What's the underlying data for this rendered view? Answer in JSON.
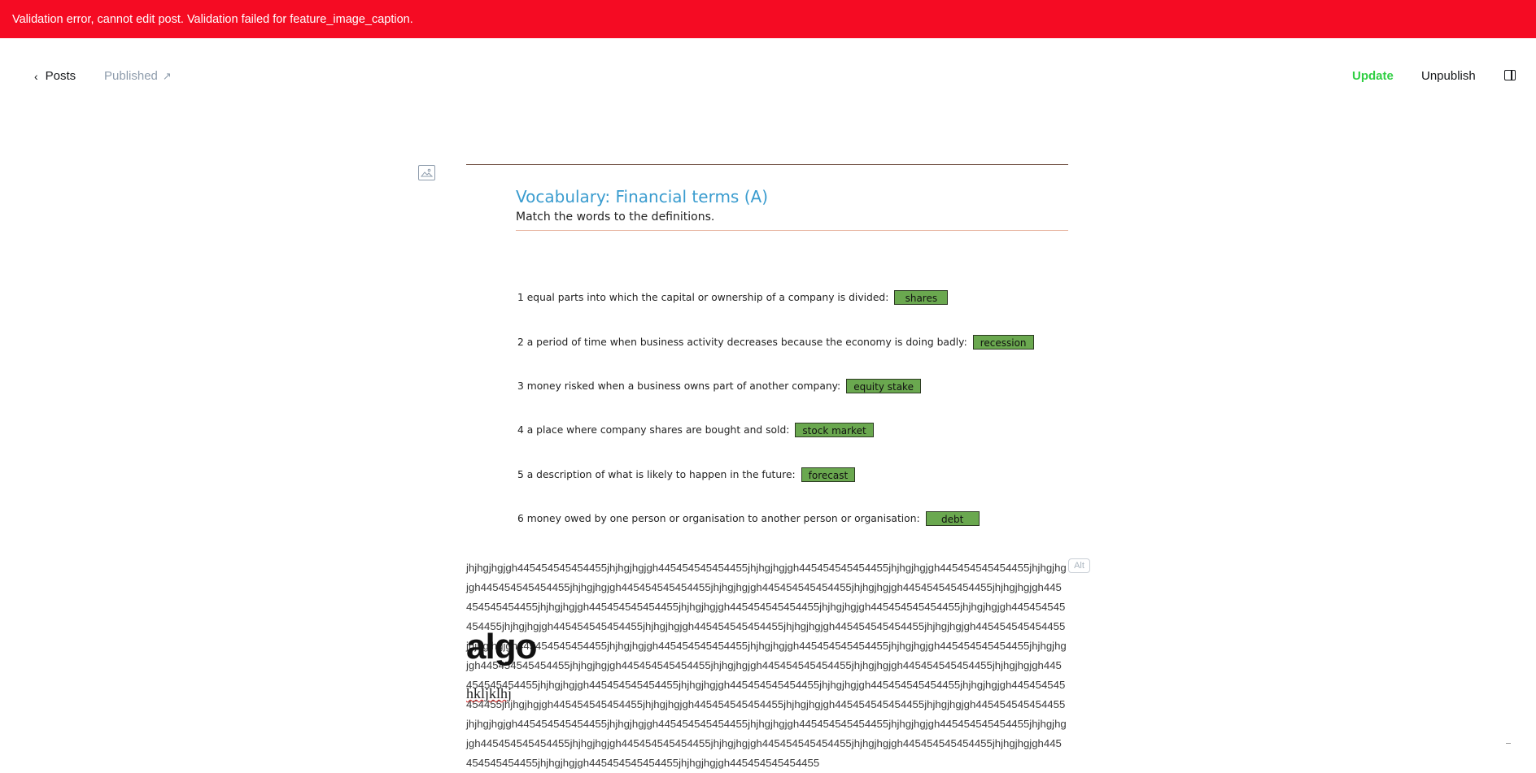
{
  "error_banner": {
    "message": "Validation error, cannot edit post. Validation failed for feature_image_caption."
  },
  "nav": {
    "back_label": "Posts",
    "status_label": "Published",
    "update_label": "Update",
    "unpublish_label": "Unpublish"
  },
  "feature_image": {
    "title": "Vocabulary: Financial terms (A)",
    "subtitle": "Match the words to the definitions.",
    "items": [
      {
        "text": "1 equal parts into which the capital or ownership of a company is divided:",
        "answer": "shares"
      },
      {
        "text": "2 a period of time when business activity decreases because the economy is doing badly:",
        "answer": "recession"
      },
      {
        "text": "3 money risked when a business owns part of another company:",
        "answer": "equity stake"
      },
      {
        "text": "4 a place where company shares are bought and sold:",
        "answer": "stock market"
      },
      {
        "text": "5 a description of what is likely to happen in the future:",
        "answer": "forecast"
      },
      {
        "text": "6 money owed by one person or organisation to another person or organisation:",
        "answer": "debt"
      }
    ],
    "alt_label": "Alt",
    "caption": "jhjhgjhgjgh445454545454455jhjhgjhgjgh445454545454455jhjhgjhgjgh445454545454455jhjhgjhgjgh445454545454455jhjhgjhgjgh445454545454455jhjhgjhgjgh445454545454455jhjhgjhgjgh445454545454455jhjhgjhgjgh445454545454455jhjhgjhgjgh445454545454455jhjhgjhgjgh445454545454455jhjhgjhgjgh445454545454455jhjhgjhgjgh445454545454455jhjhgjhgjgh445454545454455jhjhgjhgjgh445454545454455jhjhgjhgjgh445454545454455jhjhgjhgjgh445454545454455jhjhgjhgjgh445454545454455jhjhgjhgjgh445454545454455jhjhgjhgjgh445454545454455jhjhgjhgjgh445454545454455jhjhgjhgjgh445454545454455jhjhgjhgjgh445454545454455jhjhgjhgjgh445454545454455jhjhgjhgjgh445454545454455jhjhgjhgjgh445454545454455jhjhgjhgjgh445454545454455jhjhgjhgjgh445454545454455jhjhgjhgjgh445454545454455jhjhgjhgjgh445454545454455jhjhgjhgjgh445454545454455jhjhgjhgjgh445454545454455jhjhgjhgjgh445454545454455jhjhgjhgjgh445454545454455jhjhgjhgjgh445454545454455jhjhgjhgjgh445454545454455jhjhgjhgjgh445454545454455jhjhgjhgjgh445454545454455jhjhgjhgjgh445454545454455jhjhgjhgjgh445454545454455jhjhgjhgjgh445454545454455jhjhgjhgjgh445454545454455jhjhgjhgjgh445454545454455jhjhgjhgjgh445454545454455jhjhgjhgjgh445454545454455jhjhgjhgjgh445454545454455"
  },
  "post": {
    "title": "algo",
    "body": "hkljklhj"
  },
  "icons": {
    "back": "chevron-left-icon",
    "status_link": "arrow-up-right-icon",
    "sidebar": "sidebar-toggle-icon",
    "feature_image": "image-icon"
  },
  "colors": {
    "error": "#f50b23",
    "accent": "#30cf43",
    "muted": "#8e9cac",
    "worksheet_title": "#3a9ccf",
    "answer_box": "#6aa84f"
  }
}
